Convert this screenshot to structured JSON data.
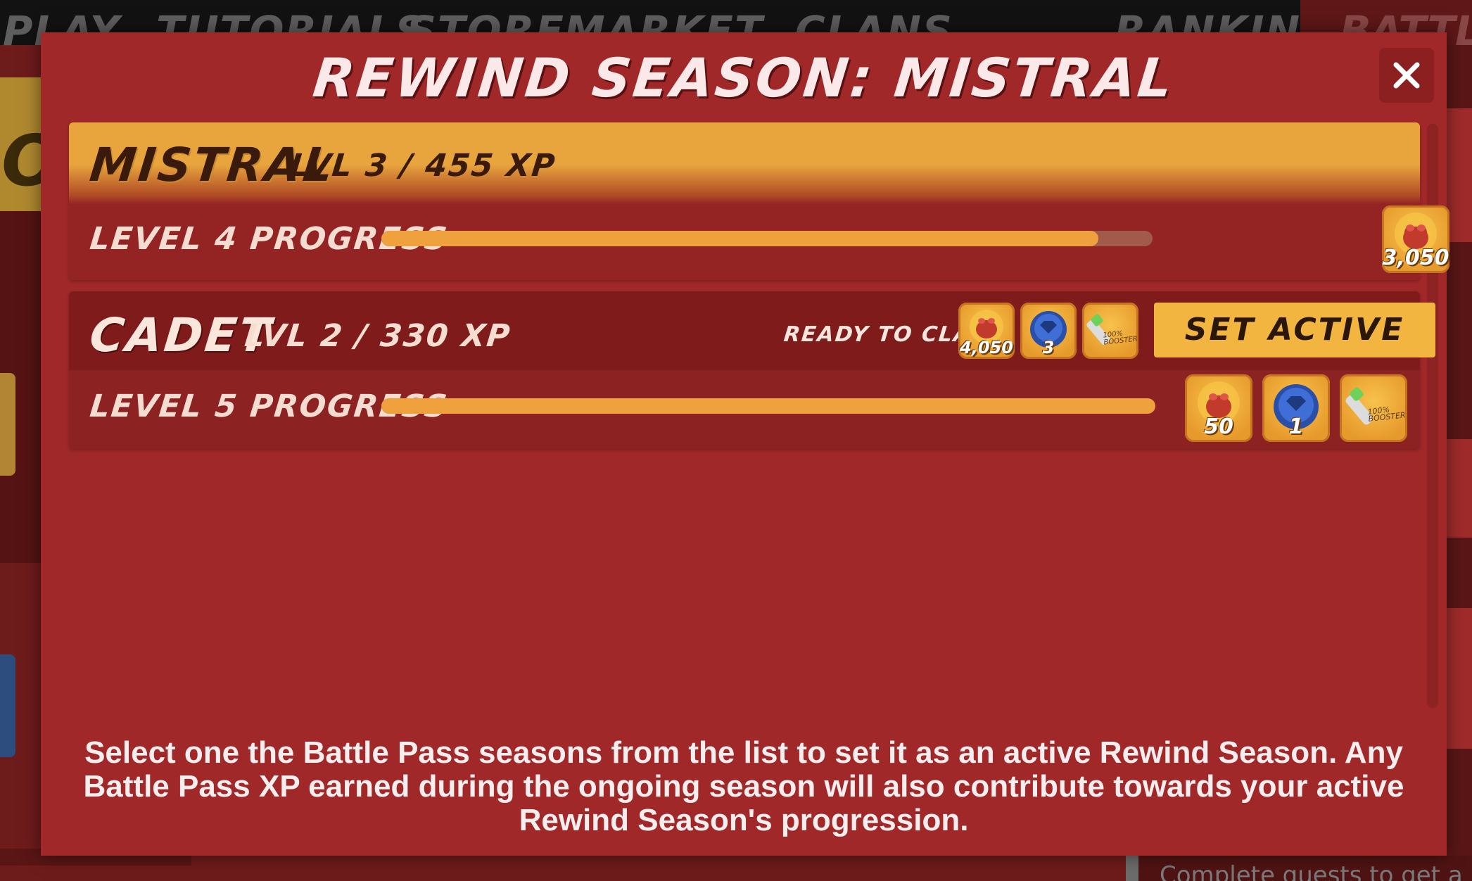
{
  "background": {
    "nav_items": [
      "PLAY",
      "TUTORIALS",
      "STORE",
      "MARKET",
      "CLANS",
      "RANKING"
    ],
    "nav_active_partial": "BATTLE P",
    "footer_partial": "Complete quests to get a"
  },
  "modal": {
    "title": "REWIND SEASON: MISTRAL",
    "close_icon": "close-icon",
    "seasons": [
      {
        "name": "MISTRAL",
        "level_text": "LVL 3 / 455 XP",
        "progress_label": "LEVEL 4 PROGRESS",
        "progress_fraction": 0.93,
        "rewards": [
          {
            "icon": "coin-sack-icon",
            "quantity": "3,050"
          }
        ]
      },
      {
        "name": "CADET",
        "level_text": "LVL 2 / 330 XP",
        "ready_label": "READY TO CLAIM:",
        "ready_rewards": [
          {
            "icon": "coin-sack-icon",
            "quantity": "4,050"
          },
          {
            "icon": "blue-gem-icon",
            "quantity": "3"
          },
          {
            "icon": "booster-icon",
            "label": "100% BOOSTER"
          }
        ],
        "set_active_label": "SET ACTIVE",
        "progress_label": "LEVEL 5 PROGRESS",
        "progress_fraction": 1.0,
        "rewards": [
          {
            "icon": "coin-sack-icon",
            "quantity": "50"
          },
          {
            "icon": "blue-gem-icon",
            "quantity": "1"
          },
          {
            "icon": "booster-icon",
            "label": "100% BOOSTER"
          }
        ]
      }
    ],
    "description": "Select one the Battle Pass seasons from the list to set it as an active Rewind Season. Any Battle Pass XP earned during the ongoing season will also contribute towards your active Rewind Season's progression."
  },
  "colors": {
    "modal_bg": "#a02828",
    "accent_orange": "#eea13c",
    "button_yellow": "#f2b640"
  }
}
